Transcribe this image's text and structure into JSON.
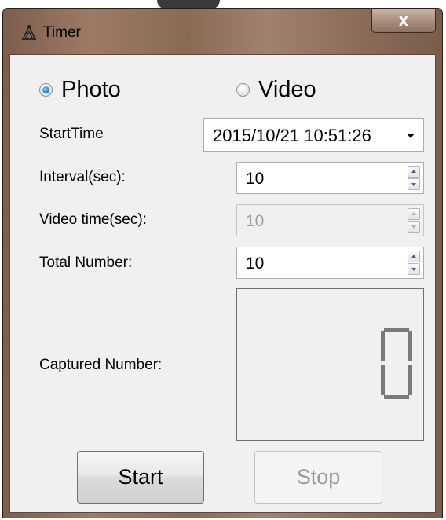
{
  "window": {
    "title": "Timer",
    "close_label": "x"
  },
  "mode": {
    "photo_label": "Photo",
    "video_label": "Video",
    "selected": "Photo"
  },
  "fields": {
    "start_time": {
      "label": "StartTime",
      "value": "2015/10/21 10:51:26"
    },
    "interval": {
      "label": "Interval(sec):",
      "value": "10"
    },
    "video_time": {
      "label": "Video time(sec):",
      "value": "10",
      "disabled": true
    },
    "total_number": {
      "label": "Total Number:",
      "value": "10"
    },
    "captured_number": {
      "label": "Captured Number:",
      "value": "0"
    }
  },
  "buttons": {
    "start_label": "Start",
    "stop_label": "Stop",
    "stop_disabled": true
  },
  "colors": {
    "titlebar": "#8a6a55",
    "client_background": "#f0f0f0",
    "radio_selected": "#2b80c8",
    "segment": "#7a7a7a",
    "disabled_text": "#9a9a9a"
  },
  "icons": {
    "app": "timer-app-icon",
    "close": "close-icon",
    "dropdown": "chevron-down-icon",
    "spin_up": "arrow-up-icon",
    "spin_down": "arrow-down-icon"
  }
}
